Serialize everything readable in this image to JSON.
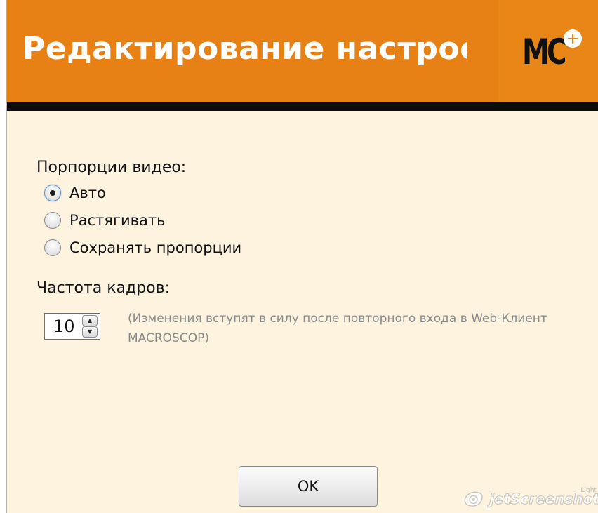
{
  "dialog": {
    "title": "Редактирование настроек",
    "logo_text": "MC",
    "logo_plus_icon": "plus-icon"
  },
  "video_proportions": {
    "label": "Порпорции видео:",
    "options": [
      {
        "label": "Авто",
        "checked": true
      },
      {
        "label": "Растягивать",
        "checked": false
      },
      {
        "label": "Сохранять пропорции",
        "checked": false
      }
    ]
  },
  "frame_rate": {
    "label": "Частота кадров:",
    "value": "10",
    "hint": "(Изменения вступят в силу после повторного входа в Web-Клиент MACROSCOP)"
  },
  "buttons": {
    "ok_label": "OK"
  },
  "watermark": {
    "text": "jetScreenshot",
    "small": "Light"
  },
  "colors": {
    "header_orange": "#e78115",
    "background": "#fef3de",
    "header_bar": "#0c0c0c"
  }
}
